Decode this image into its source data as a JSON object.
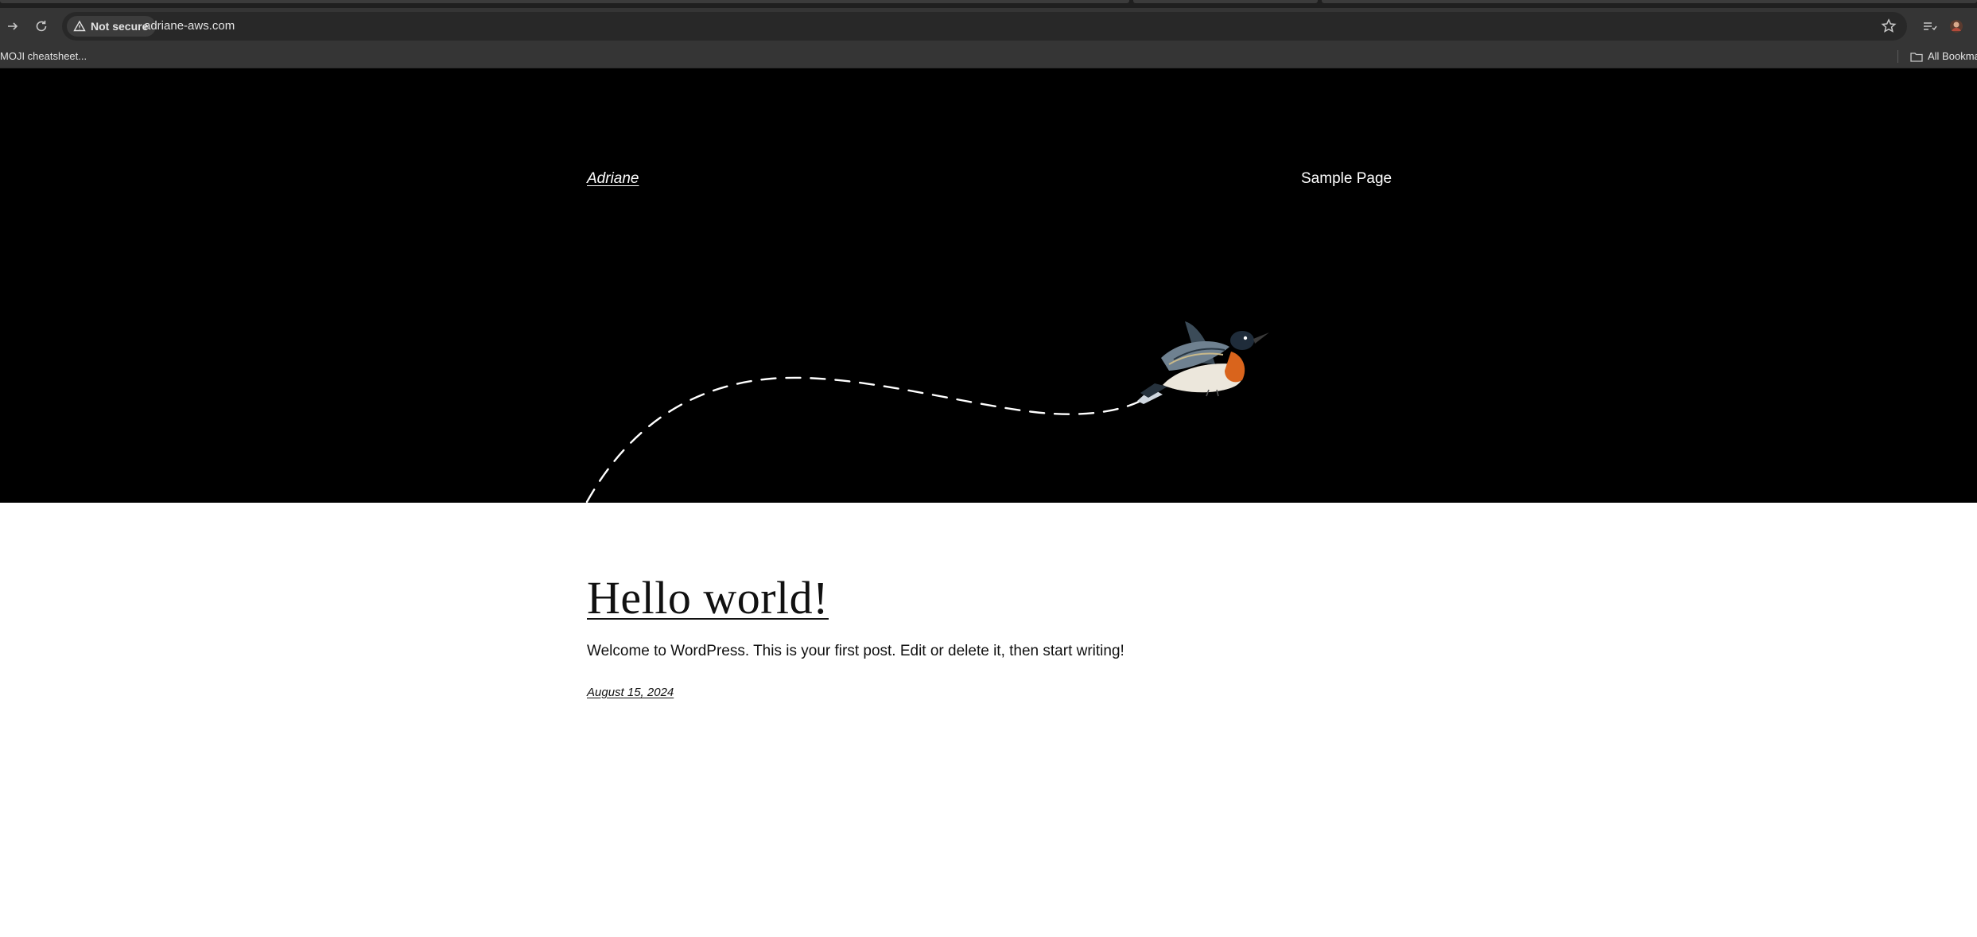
{
  "browser": {
    "security_label": "Not secure",
    "url": "adriane-aws.com",
    "bookmarks": {
      "first_item": "MOJI cheatsheet...",
      "all_bookmarks": "All Bookma"
    }
  },
  "site": {
    "title": "Adriane",
    "nav": {
      "sample_page": "Sample Page"
    }
  },
  "post": {
    "title": "Hello world!",
    "excerpt": "Welcome to WordPress. This is your first post. Edit or delete it, then start writing!",
    "date": "August 15, 2024"
  },
  "colors": {
    "header_bg": "#000000",
    "content_bg": "#ffffff",
    "browser_toolbar": "#353535"
  }
}
